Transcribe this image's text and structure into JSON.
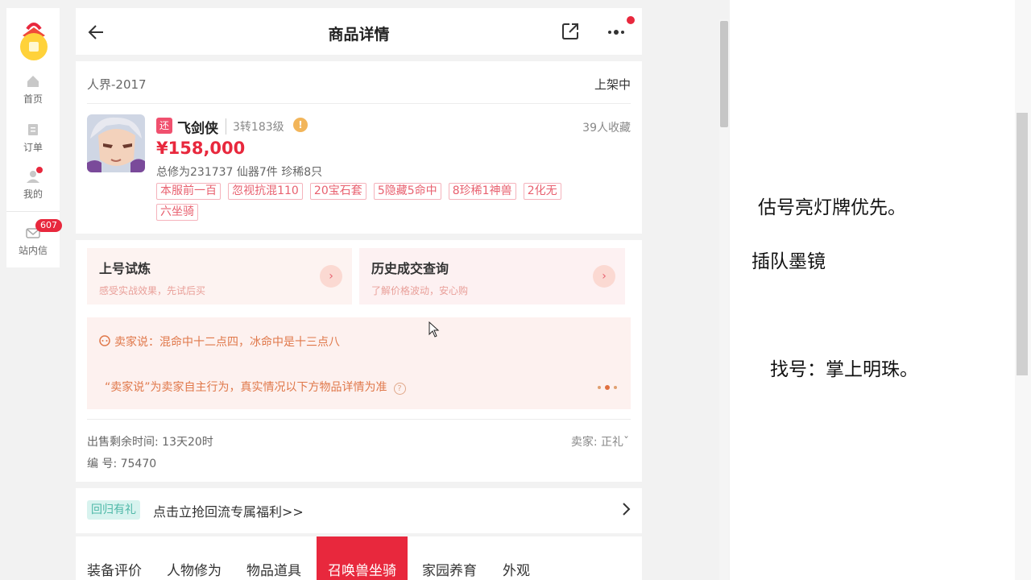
{
  "sidebar": {
    "items": [
      {
        "label": "首页"
      },
      {
        "label": "订单"
      },
      {
        "label": "我的"
      },
      {
        "label": "站内信",
        "badge": "607"
      }
    ]
  },
  "header": {
    "title": "商品详情"
  },
  "listing": {
    "server": "人界-2017",
    "status": "上架中",
    "tag": "还",
    "role": "飞剑侠",
    "level": "3转183级",
    "favorites": "39人收藏",
    "price": "¥158,000",
    "stats": "总修为231737  仙器7件  珍稀8只",
    "chips": [
      "本服前一百",
      "忽视抗混110",
      "20宝石套",
      "5隐藏5命中",
      "8珍稀1神兽",
      "2化无",
      "六坐骑"
    ]
  },
  "entries": [
    {
      "title": "上号试炼",
      "sub": "感受实战效果，先试后买"
    },
    {
      "title": "历史成交查询",
      "sub": "了解价格波动，安心购"
    }
  ],
  "seller_note": {
    "text": "卖家说：混命中十二点四，冰命中是十三点八",
    "disclaimer": "“卖家说”为卖家自主行为，真实情况以下方物品详情为准"
  },
  "meta": {
    "time_left": "出售剩余时间: 13天20时",
    "seller": "卖家: 正礼ˇ",
    "serial": "编 号: 75470"
  },
  "gift": {
    "tag": "回归有礼",
    "text": "点击立抢回流专属福利>>"
  },
  "tabs": [
    "装备评价",
    "人物修为",
    "物品道具",
    "召唤兽坐骑",
    "家园养育",
    "外观"
  ],
  "notes": [
    "估号亮灯牌优先。",
    "插队墨镜",
    "找号：掌上明珠。"
  ],
  "colors": {
    "accent": "#e8283d",
    "bg": "#f2f2f2"
  }
}
